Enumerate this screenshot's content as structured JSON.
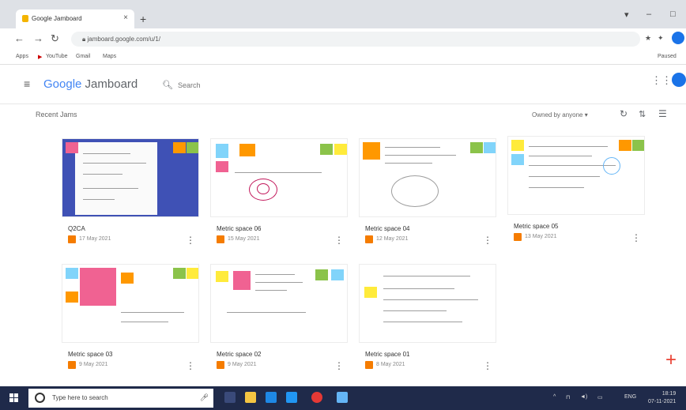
{
  "browser": {
    "tab_title": "Google Jamboard",
    "url": "jamboard.google.com/u/1/",
    "bookmarks": [
      "Apps",
      "YouTube",
      "Gmail",
      "Maps"
    ],
    "profile_label": "Paused"
  },
  "app": {
    "brand_prefix": "Google",
    "brand_suffix": "Jamboard",
    "search_placeholder": "Search"
  },
  "section": {
    "heading": "Recent Jams",
    "filter_label": "Owned by anyone ▾"
  },
  "jams": [
    {
      "title": "Q2CA",
      "date": "17 May 2021"
    },
    {
      "title": "Metric space 06",
      "date": "15 May 2021"
    },
    {
      "title": "Metric space 04",
      "date": "12 May 2021"
    },
    {
      "title": "Metric space 05",
      "date": "13 May 2021"
    },
    {
      "title": "Metric space 03",
      "date": "9 May 2021"
    },
    {
      "title": "Metric space 02",
      "date": "9 May 2021"
    },
    {
      "title": "Metric space 01",
      "date": "8 May 2021"
    }
  ],
  "taskbar": {
    "search_placeholder": "Type here to search",
    "time": "18:19",
    "date": "07-11-2021",
    "lang": "ENG"
  },
  "colors": {
    "accent": "#1a73e8",
    "jam_icon": "#f57c00",
    "sticky_green": "#8bc34a",
    "sticky_orange": "#ff9800",
    "sticky_pink": "#f06292",
    "sticky_blue": "#81d4fa",
    "sticky_yellow": "#ffeb3b"
  }
}
